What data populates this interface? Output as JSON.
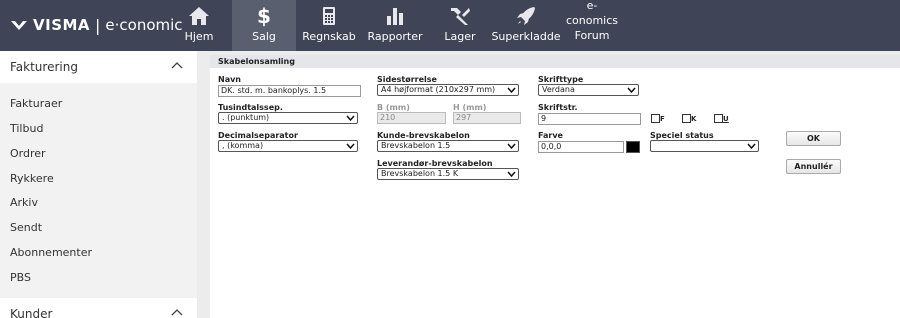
{
  "topbar": {
    "brand": "VISMA",
    "separator": "|",
    "product": "e·conomic",
    "nav": [
      {
        "label": "Hjem",
        "icon": "home-icon"
      },
      {
        "label": "Salg",
        "icon": "dollar-icon",
        "active": true
      },
      {
        "label": "Regnskab",
        "icon": "calculator-icon"
      },
      {
        "label": "Rapporter",
        "icon": "bar-chart-icon"
      },
      {
        "label": "Lager",
        "icon": "tools-icon"
      },
      {
        "label": "Superkladde",
        "icon": "rocket-icon"
      },
      {
        "label_line1": "e-conomics",
        "label_line2": "Forum"
      }
    ]
  },
  "sidebar": {
    "section1": "Fakturering",
    "items": [
      "Fakturaer",
      "Tilbud",
      "Ordrer",
      "Rykkere",
      "Arkiv",
      "Sendt",
      "Abonnementer",
      "PBS"
    ],
    "section2": "Kunder"
  },
  "form": {
    "title": "Skabelonsamling",
    "navn_label": "Navn",
    "navn_value": "DK. std. m. bankoplys. 1.5",
    "sidestorrelse_label": "Sidestørrelse",
    "sidestorrelse_value": "A4 højformat (210x297 mm)",
    "skrifttype_label": "Skrifttype",
    "skrifttype_value": "Verdana",
    "tusind_label": "Tusindtalssep.",
    "tusind_value": ". (punktum)",
    "b_label": "B (mm)",
    "b_value": "210",
    "h_label": "H (mm)",
    "h_value": "297",
    "skriftstr_label": "Skriftstr.",
    "skriftstr_value": "9",
    "style_f": "F",
    "style_k": "K",
    "style_u": "U",
    "decimal_label": "Decimalseparator",
    "decimal_value": ", (komma)",
    "kunde_label": "Kunde-brevskabelon",
    "kunde_value": "Brevskabelon 1.5",
    "farve_label": "Farve",
    "farve_value": "0,0,0",
    "farve_color": "#000000",
    "speciel_label": "Speciel status",
    "speciel_value": "",
    "leverandor_label": "Leverandør-brevskabelon",
    "leverandor_value": "Brevskabelon 1.5 K",
    "ok_label": "OK",
    "cancel_label": "Annullér"
  }
}
